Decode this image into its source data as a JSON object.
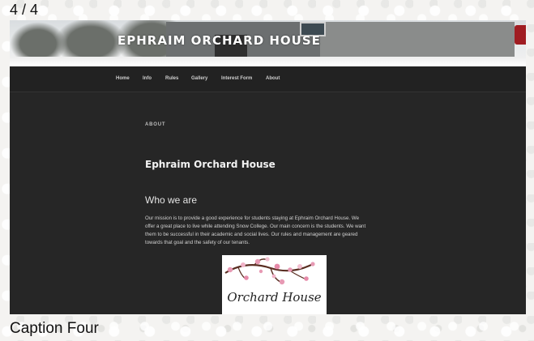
{
  "slideshow": {
    "counter": "4 / 4",
    "caption": "Caption Four"
  },
  "site": {
    "title": "EPHRAIM ORCHARD HOUSE"
  },
  "nav": {
    "items": [
      "Home",
      "Info",
      "Rules",
      "Gallery",
      "Interest Form",
      "About"
    ]
  },
  "page": {
    "eyebrow": "ABOUT",
    "heading": "Ephraim Orchard House",
    "subheading": "Who we are",
    "body_lines": [
      "Our mission is to provide a good experience for students staying at Ephraim Orchard House. We",
      "offer a great place to live while attending Snow College. Our main concern is the students. We want",
      "them to be successful in their academic and social lives. Our rules and management are geared",
      "towards that goal and the safety of our tenants."
    ]
  },
  "logo": {
    "text": "Orchard House"
  },
  "colors": {
    "content_bg": "#262626",
    "nav_bg": "#222222",
    "page_bg": "#f4f3f1",
    "blossom": "#e79ab4"
  }
}
